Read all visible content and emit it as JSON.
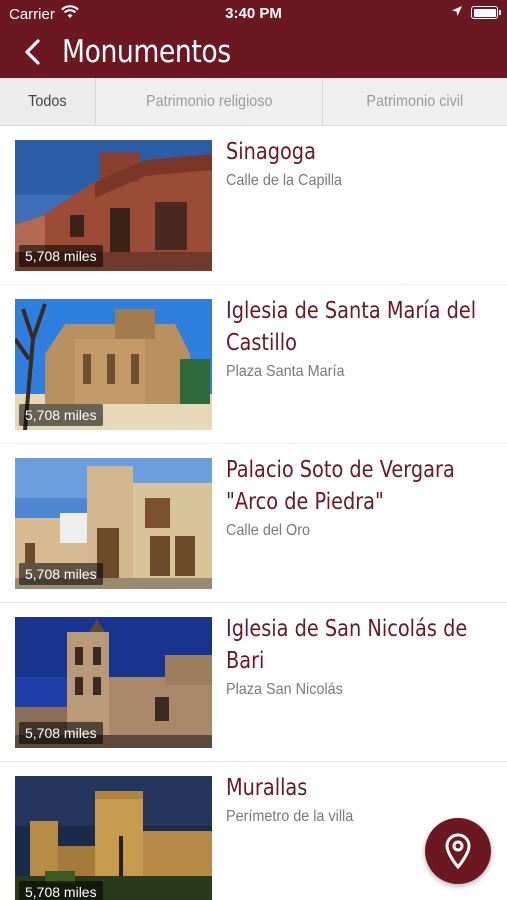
{
  "status_bar": {
    "carrier": "Carrier",
    "time": "3:40 PM"
  },
  "navbar": {
    "title": "Monumentos",
    "back_icon": "chevron-left-icon"
  },
  "tabs": [
    {
      "label": "Todos",
      "active": true
    },
    {
      "label": "Patrimonio religioso",
      "active": false
    },
    {
      "label": "Patrimonio civil",
      "active": false
    }
  ],
  "monuments": [
    {
      "title": "Sinagoga",
      "address": "Calle de la Capilla",
      "distance": "5,708 miles"
    },
    {
      "title": "Iglesia de Santa María del Castillo",
      "address": "Plaza Santa María",
      "distance": "5,708 miles"
    },
    {
      "title": "Palacio Soto de Vergara \"Arco de Piedra\"",
      "address": "Calle del Oro",
      "distance": "5,708 miles"
    },
    {
      "title": "Iglesia de San Nicolás de Bari",
      "address": "Plaza San Nicolás",
      "distance": "5,708 miles"
    },
    {
      "title": "Murallas",
      "address": "Perímetro de la villa",
      "distance": "5,708 miles"
    }
  ],
  "fab": {
    "icon": "map-pin-icon"
  },
  "colors": {
    "brand": "#6b1822",
    "tab_bg": "#efefef",
    "address_text": "#7a7a7a"
  }
}
